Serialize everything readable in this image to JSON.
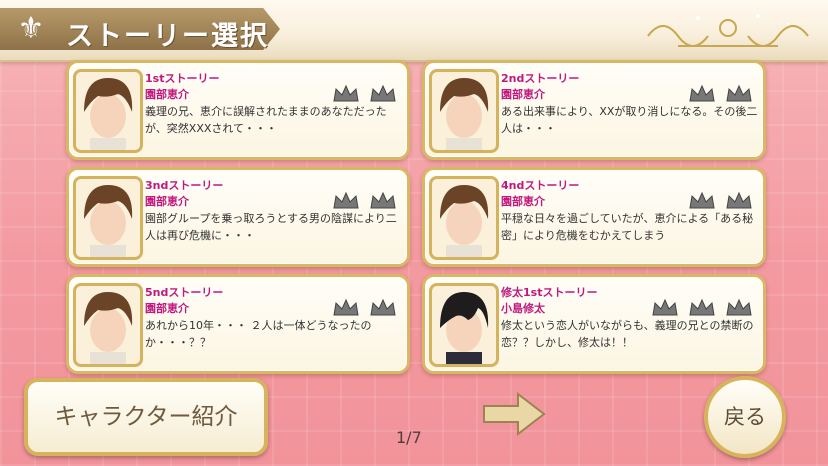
{
  "header": {
    "title": "ストーリー選択"
  },
  "stories": [
    {
      "title": "1stストーリー",
      "name": "園部恵介",
      "desc": "義理の兄、恵介に誤解されたままのあなただったが、突然XXXされて・・・",
      "crowns": 2
    },
    {
      "title": "2ndストーリー",
      "name": "園部恵介",
      "desc": "ある出来事により、XXが取り消しになる。その後二人は・・・",
      "crowns": 2
    },
    {
      "title": "3ndストーリー",
      "name": "園部恵介",
      "desc": "園部グループを乗っ取ろうとする男の陰謀により二人は再び危機に・・・",
      "crowns": 2
    },
    {
      "title": "4ndストーリー",
      "name": "園部恵介",
      "desc": "平穏な日々を過ごしていたが、恵介による「ある秘密」により危機をむかえてしまう",
      "crowns": 2
    },
    {
      "title": "5ndストーリー",
      "name": "園部恵介",
      "desc": "あれから10年・・・ ２人は一体どうなったのか・・・？？",
      "crowns": 2
    },
    {
      "title": "修太1stストーリー",
      "name": "小島修太",
      "desc": "修太という恋人がいながらも、義理の兄との禁断の恋？？しかし、修太は！！",
      "crowns": 3
    }
  ],
  "footer": {
    "characters_label": "キャラクター紹介",
    "page": "1/7",
    "back_label": "戻る"
  },
  "colors": {
    "accent": "#c0187f",
    "gold": "#d9b763"
  }
}
